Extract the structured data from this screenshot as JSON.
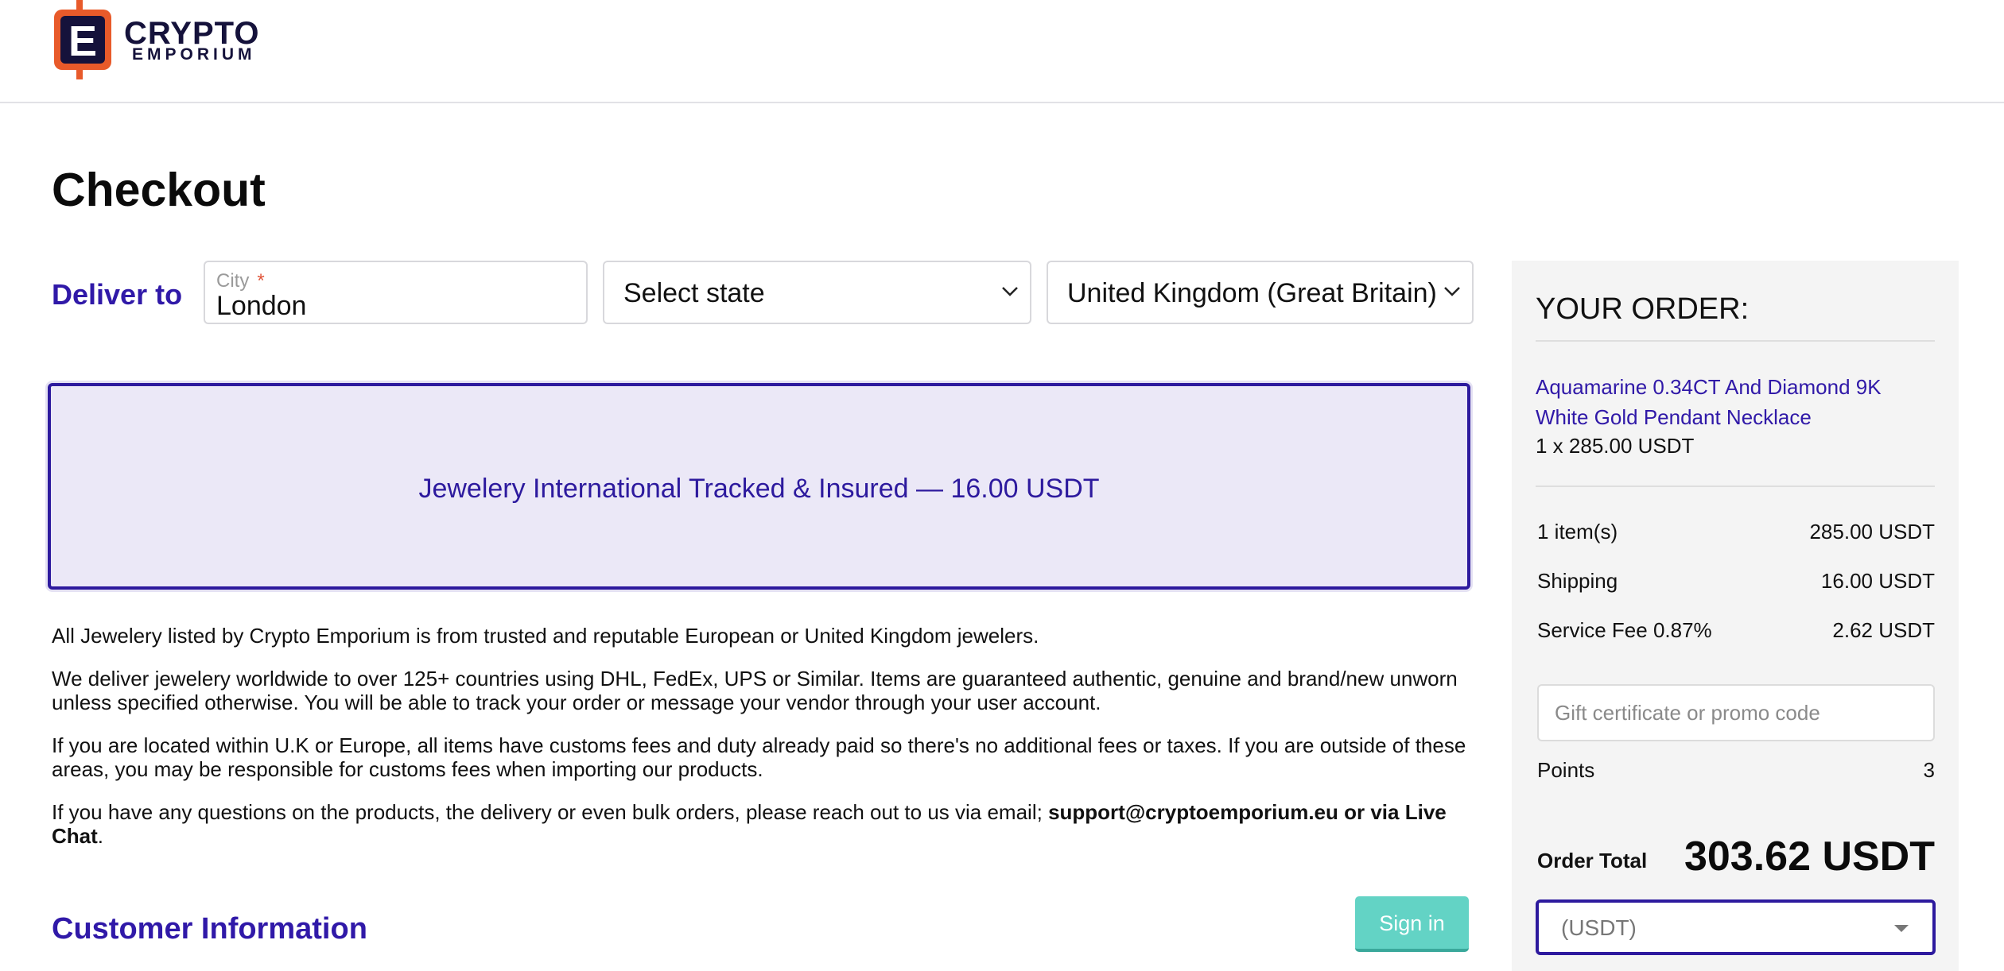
{
  "brand": {
    "logo_letter": "E",
    "name_line1": "CRYPTO",
    "name_line2": "EMPORIUM",
    "accent_color": "#e85a2a",
    "dark_color": "#15123b"
  },
  "page": {
    "title": "Checkout"
  },
  "delivery": {
    "label": "Deliver to",
    "city_label": "City",
    "city_required_mark": "*",
    "city_value": "London",
    "state_value": "Select state",
    "country_value": "United Kingdom (Great Britain)"
  },
  "shipping_option": {
    "label": "Jewelery International Tracked & Insured — 16.00 USDT",
    "selected": true
  },
  "info": {
    "p1": "All Jewelery listed by Crypto Emporium is from trusted and reputable European or United Kingdom jewelers.",
    "p2": "We deliver jewelery worldwide to over 125+ countries using DHL, FedEx, UPS or Similar. Items are guaranteed authentic, genuine and brand/new unworn unless specified otherwise. You will be able to track your order or message your vendor through your user account.",
    "p3": "If you are located within U.K or Europe, all items have customs fees and duty already paid so there's no additional fees or taxes. If you are outside of these areas, you may be responsible for customs fees when importing our products.",
    "p4_start": "If you have any questions on the products, the delivery or even bulk orders, please reach out to us via email; ",
    "p4_email": "support@cryptoemporium.eu",
    "p4_or": " or ",
    "p4_chat": "via Live Chat",
    "p4_end": "."
  },
  "customer": {
    "title": "Customer Information",
    "signin_label": "Sign in"
  },
  "order": {
    "title": "YOUR ORDER:",
    "product_name": "Aquamarine 0.34CT And Diamond 9K White Gold Pendant Necklace",
    "product_qty": "1 x 285.00 USDT",
    "items_label": "1 item(s)",
    "items_value": "285.00 USDT",
    "shipping_label": "Shipping",
    "shipping_value": "16.00 USDT",
    "fee_label": "Service Fee 0.87%",
    "fee_value": "2.62 USDT",
    "promo_placeholder": "Gift certificate or promo code",
    "points_label": "Points",
    "points_value": "3",
    "total_label": "Order Total",
    "total_value": "303.62 USDT",
    "currency_value": "(USDT)"
  }
}
